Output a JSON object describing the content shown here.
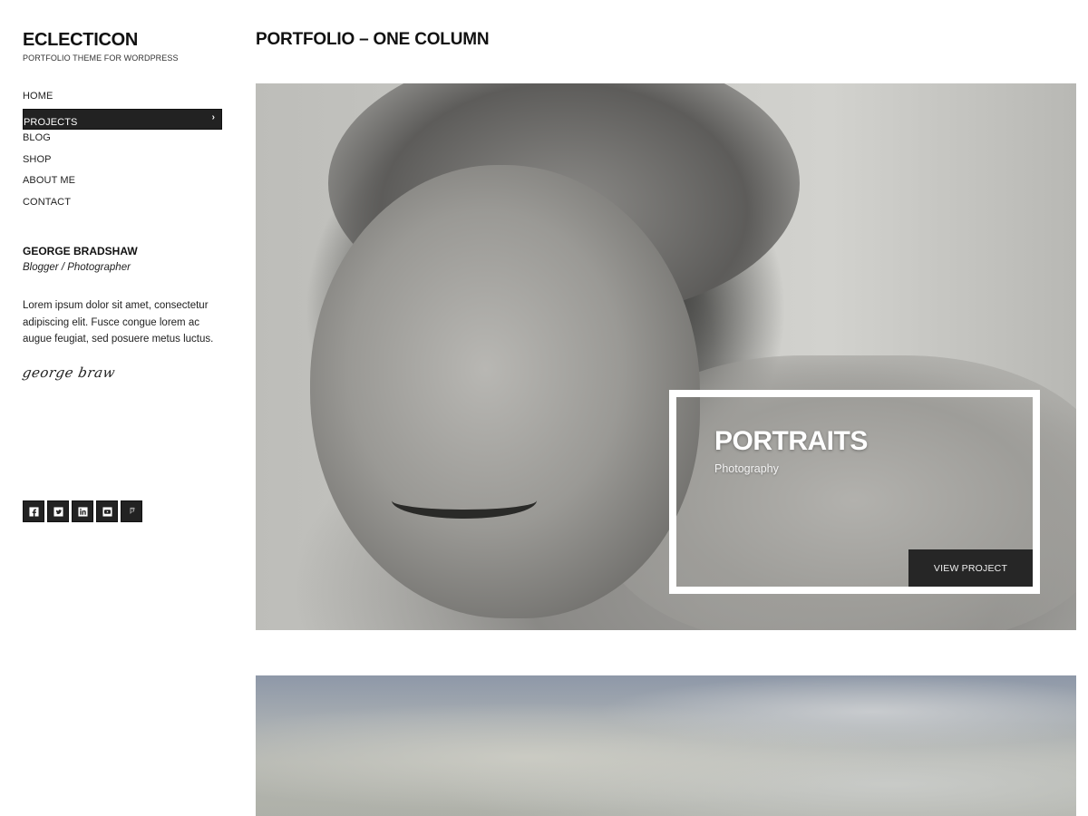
{
  "site": {
    "title": "ECLECTICON",
    "tagline": "PORTFOLIO THEME FOR WORDPRESS"
  },
  "nav": {
    "items": [
      {
        "label": "HOME",
        "active": false
      },
      {
        "label": "PROJECTS",
        "active": true,
        "submenu_indicator": "›"
      },
      {
        "label": "BLOG",
        "active": false
      },
      {
        "label": "SHOP",
        "active": false
      },
      {
        "label": "ABOUT ME",
        "active": false
      },
      {
        "label": "CONTACT",
        "active": false
      }
    ]
  },
  "author": {
    "name": "GEORGE BRADSHAW",
    "role": "Blogger / Photographer",
    "bio": "Lorem ipsum dolor sit amet, consectetur adipiscing elit. Fusce congue lorem ac augue feugiat, sed posuere metus luctus.",
    "signature": "george braw"
  },
  "social": [
    {
      "name": "facebook-icon"
    },
    {
      "name": "twitter-icon"
    },
    {
      "name": "linkedin-icon"
    },
    {
      "name": "youtube-icon"
    },
    {
      "name": "foursquare-icon"
    }
  ],
  "main": {
    "page_title": "PORTFOLIO – ONE COLUMN",
    "projects": [
      {
        "title": "PORTRAITS",
        "category": "Photography",
        "button_label": "VIEW PROJECT",
        "image": "black-and-white-portrait-of-smiling-elderly-woman"
      },
      {
        "image": "cloudy-sky-landscape"
      }
    ]
  },
  "colors": {
    "accent_dark": "#222222",
    "background": "#ffffff",
    "text": "#222222"
  }
}
